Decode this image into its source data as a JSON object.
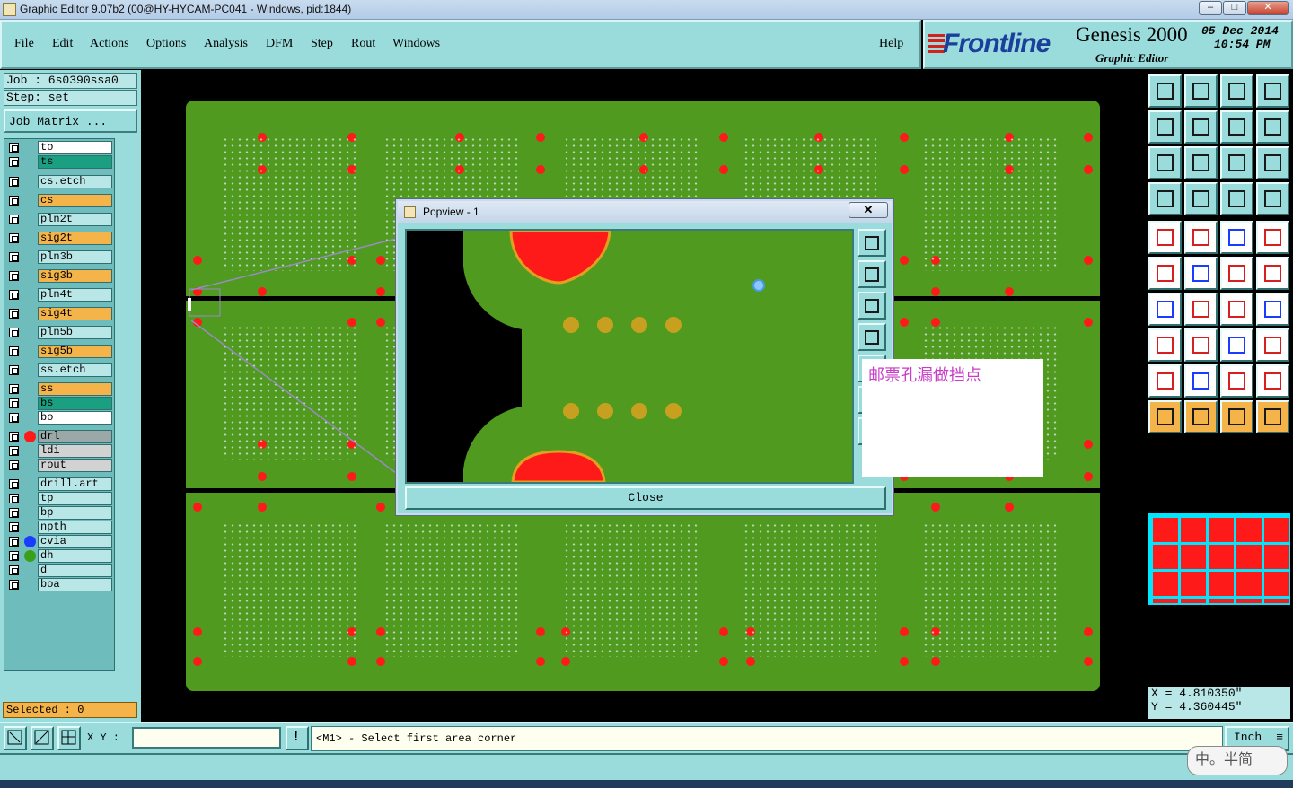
{
  "window": {
    "title": "Graphic Editor 9.07b2 (00@HY-HYCAM-PC041 - Windows, pid:1844)",
    "minimize": "–",
    "maximize": "□",
    "close": "✕"
  },
  "menu": [
    {
      "label": "File"
    },
    {
      "label": "Edit"
    },
    {
      "label": "Actions"
    },
    {
      "label": "Options"
    },
    {
      "label": "Analysis"
    },
    {
      "label": "DFM"
    },
    {
      "label": "Step"
    },
    {
      "label": "Rout"
    },
    {
      "label": "Windows"
    }
  ],
  "help": "Help",
  "brand": {
    "logo": "Frontline",
    "product": "Genesis 2000",
    "subtitle": "Graphic Editor",
    "date": "05 Dec 2014",
    "time": "10:54 PM"
  },
  "job": {
    "job": "Job  :  6s0390ssa0",
    "step": "Step:  set",
    "matrix_button": "Job Matrix ..."
  },
  "layers": [
    {
      "name": "to",
      "color": "#ffffff"
    },
    {
      "name": "ts",
      "color": "#1aa080"
    },
    {
      "name": "cs.etch",
      "color": "#b9e6e6"
    },
    {
      "name": "cs",
      "color": "#f5b449"
    },
    {
      "name": "pln2t",
      "color": "#b9e6e6"
    },
    {
      "name": "sig2t",
      "color": "#f5b449"
    },
    {
      "name": "pln3b",
      "color": "#b9e6e6"
    },
    {
      "name": "sig3b",
      "color": "#f5b449"
    },
    {
      "name": "pln4t",
      "color": "#b9e6e6"
    },
    {
      "name": "sig4t",
      "color": "#f5b449"
    },
    {
      "name": "pln5b",
      "color": "#b9e6e6"
    },
    {
      "name": "sig5b",
      "color": "#f5b449"
    },
    {
      "name": "ss.etch",
      "color": "#b9e6e6"
    },
    {
      "name": "ss",
      "color": "#f5b449"
    },
    {
      "name": "bs",
      "color": "#1aa080"
    },
    {
      "name": "bo",
      "color": "#ffffff"
    },
    {
      "name": "drl",
      "color": "#9aa8a8",
      "dot": "#ff1a1a"
    },
    {
      "name": "ldi",
      "color": "#d2d2d2"
    },
    {
      "name": "rout",
      "color": "#d2d2d2"
    },
    {
      "name": "drill.art",
      "color": "#b9e6e6"
    },
    {
      "name": "tp",
      "color": "#b9e6e6"
    },
    {
      "name": "bp",
      "color": "#b9e6e6"
    },
    {
      "name": "npth",
      "color": "#b9e6e6"
    },
    {
      "name": "cvia",
      "color": "#b9e6e6",
      "dot": "#1a3cff"
    },
    {
      "name": "dh",
      "color": "#b9e6e6",
      "dot": "#3aa01a"
    },
    {
      "name": "d",
      "color": "#b9e6e6"
    },
    {
      "name": "boa",
      "color": "#b9e6e6"
    }
  ],
  "selected": "Selected : 0",
  "toolbar_icons": [
    "open-step-icon",
    "close-step-icon",
    "home-icon",
    "window-icon",
    "pan-left-icon",
    "pan-right-icon",
    "mirror-icon",
    "snap-icon",
    "zoom-fit-icon",
    "zoom-home-icon",
    "scale-1-2-icon",
    "help-query-icon",
    "graphic-control-icon",
    "grid-icon",
    "layer-stack-icon",
    "layer-compare-icon",
    "add-pad-icon",
    "add-line-icon",
    "ruler-icon",
    "circle-fill-icon",
    "node-edit-icon",
    "cross-icon",
    "arc-add-icon",
    "arc-move-icon",
    "angle-icon",
    "slash-icon",
    "rotate-icon",
    "text-f-icon",
    "resize-icon",
    "line-mid-icon",
    "measure-icon",
    "copy-icon",
    "triangle-icon",
    "triangle-up-icon",
    "arch-icon",
    "arch-flat-icon",
    "pointer-icon",
    "select-pointer-icon",
    "lasso-pointer-icon",
    "route-pointer-icon"
  ],
  "coords": {
    "x": "X  =  4.810350\"",
    "y": "Y  =  4.360445\""
  },
  "bottom": {
    "xy_label": "X Y :",
    "xy_value": "",
    "prompt": "<M1> - Select first area corner",
    "units": "Inch"
  },
  "popview": {
    "title": "Popview - 1",
    "close_x": "✕",
    "close_button": "Close"
  },
  "note": "邮票孔漏做挡点",
  "ime": "中。半简"
}
